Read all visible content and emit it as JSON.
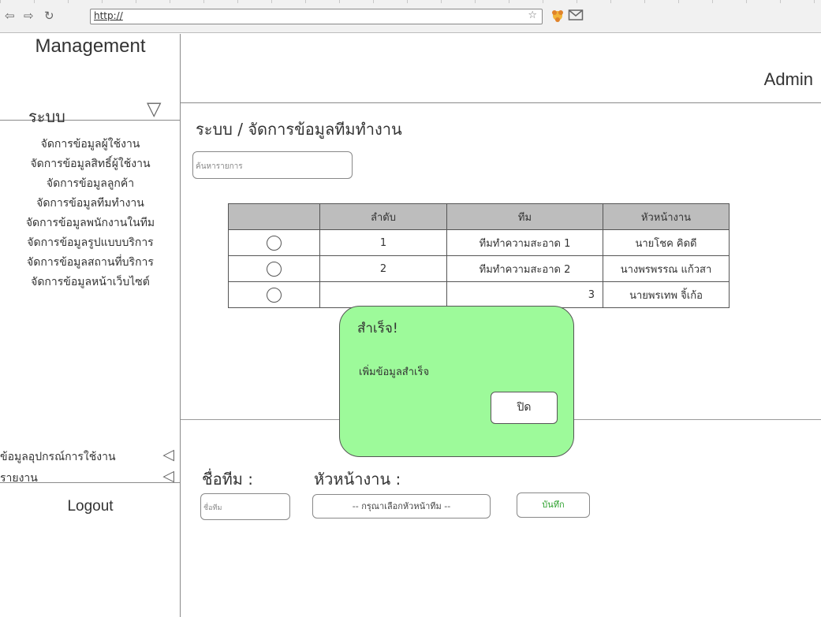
{
  "browser": {
    "url": "http://",
    "back_glyph": "⇦",
    "forward_glyph": "⇨",
    "reload_glyph": "↻",
    "star_glyph": "☆"
  },
  "sidebar": {
    "brand": "Management",
    "section_label": "ระบบ",
    "section_caret": "▽",
    "items": [
      {
        "label": "จัดการข้อมูลผู้ใช้งาน"
      },
      {
        "label": "จัดการข้อมูลสิทธิ์ผู้ใช้งาน"
      },
      {
        "label": "จัดการข้อมูลลูกค้า"
      },
      {
        "label": "จัดการข้อมูลทีมทำงาน"
      },
      {
        "label": "จัดการข้อมูลพนักงานในทีม"
      },
      {
        "label": "จัดการข้อมูลรูปแบบบริการ"
      },
      {
        "label": "จัดการข้อมูลสถานที่บริการ"
      },
      {
        "label": "จัดการข้อมูลหน้าเว็บไซต์"
      }
    ],
    "extra_items": [
      {
        "label": "ข้อมูลอุปกรณ์การใช้งาน",
        "caret": "◁"
      },
      {
        "label": "รายงาน",
        "caret": "◁"
      }
    ],
    "logout": "Logout"
  },
  "header": {
    "user": "Admin"
  },
  "main": {
    "breadcrumb": "ระบบ / จัดการข้อมูลทีมทำงาน",
    "search_placeholder": "ค้นหารายการ",
    "table": {
      "headers": [
        "",
        "ลำดับ",
        "ทีม",
        "หัวหน้างาน"
      ],
      "rows": [
        {
          "no": "1",
          "team": "ทีมทำความสะอาด 1",
          "leader": "นายโชค คิดดี"
        },
        {
          "no": "2",
          "team": "ทีมทำความสะอาด 2",
          "leader": "นางพรพรรณ แก้วสา"
        },
        {
          "no": "",
          "team": "3",
          "leader": "นายพรเทพ จิ้เก้อ"
        }
      ]
    },
    "form": {
      "team_label": "ชื่อทีม :",
      "leader_label": "หัวหน้างาน :",
      "team_placeholder": "ชื่อทีม",
      "leader_select": "-- กรุณาเลือกหัวหน้าทีม --",
      "save_label": "บันทึก"
    }
  },
  "modal": {
    "title": "สำเร็จ!",
    "message": "เพิ่มข้อมูลสำเร็จ",
    "close_label": "ปิด"
  },
  "colors": {
    "modal_bg": "#9dfa9a",
    "table_header_bg": "#bdbdbd",
    "save_text": "#2ca02c"
  }
}
